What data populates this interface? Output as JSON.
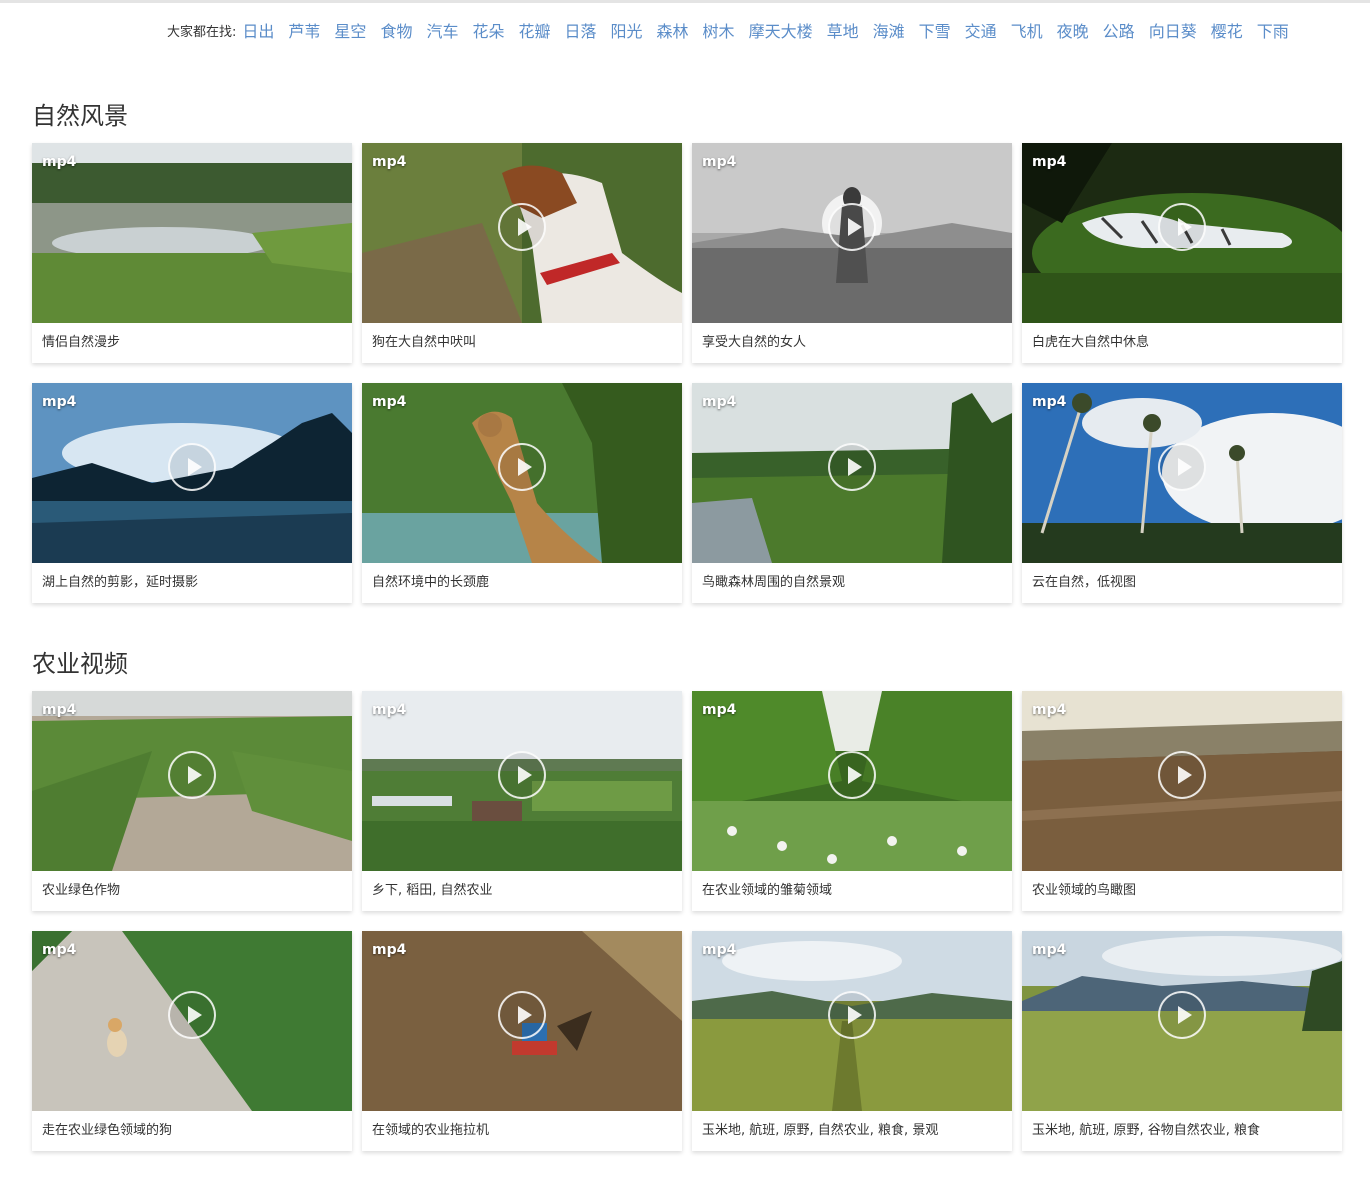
{
  "search_tags": {
    "label": "大家都在找:",
    "items": [
      "日出",
      "芦苇",
      "星空",
      "食物",
      "汽车",
      "花朵",
      "花瓣",
      "日落",
      "阳光",
      "森林",
      "树木",
      "摩天大楼",
      "草地",
      "海滩",
      "下雪",
      "交通",
      "飞机",
      "夜晚",
      "公路",
      "向日葵",
      "樱花",
      "下雨"
    ]
  },
  "sections": [
    {
      "title": "自然风景",
      "videos": [
        {
          "format": "mp4",
          "caption": "情侣自然漫步"
        },
        {
          "format": "mp4",
          "caption": "狗在大自然中吠叫"
        },
        {
          "format": "mp4",
          "caption": "享受大自然的女人"
        },
        {
          "format": "mp4",
          "caption": "白虎在大自然中休息"
        },
        {
          "format": "mp4",
          "caption": "湖上自然的剪影，延时摄影"
        },
        {
          "format": "mp4",
          "caption": "自然环境中的长颈鹿"
        },
        {
          "format": "mp4",
          "caption": "鸟瞰森林周围的自然景观"
        },
        {
          "format": "mp4",
          "caption": "云在自然，低视图"
        }
      ]
    },
    {
      "title": "农业视频",
      "videos": [
        {
          "format": "mp4",
          "caption": "农业绿色作物"
        },
        {
          "format": "mp4",
          "caption": "乡下, 稻田, 自然农业"
        },
        {
          "format": "mp4",
          "caption": "在农业领域的雏菊领域"
        },
        {
          "format": "mp4",
          "caption": "农业领域的鸟瞰图"
        },
        {
          "format": "mp4",
          "caption": "走在农业绿色领域的狗"
        },
        {
          "format": "mp4",
          "caption": "在领域的农业拖拉机"
        },
        {
          "format": "mp4",
          "caption": "玉米地, 航班, 原野, 自然农业, 粮食, 景观"
        },
        {
          "format": "mp4",
          "caption": "玉米地, 航班, 原野, 谷物自然农业, 粮食"
        }
      ]
    }
  ]
}
